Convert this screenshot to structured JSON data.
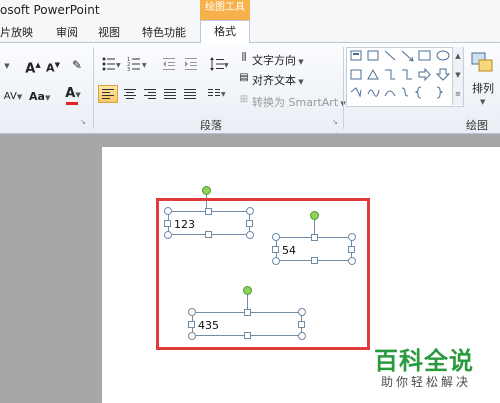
{
  "titlebar": {
    "title": "osoft PowerPoint",
    "contextual_tab": "绘图工具"
  },
  "tabs": [
    {
      "label": "片放映",
      "active": false
    },
    {
      "label": "审阅",
      "active": false
    },
    {
      "label": "视图",
      "active": false
    },
    {
      "label": "特色功能",
      "active": false
    },
    {
      "label": "格式",
      "active": true
    }
  ],
  "ribbon": {
    "font_group": {
      "grow_label": "A",
      "shrink_label": "A",
      "spacing_label": "AV",
      "case_label": "Aa",
      "color_label": "A"
    },
    "paragraph_group": {
      "label": "段落",
      "text_direction": "文字方向",
      "align_text": "对齐文本",
      "convert_smartart": "转换为 SmartArt"
    },
    "drawing_group": {
      "label": "绘图",
      "arrange": "排列"
    }
  },
  "slide": {
    "textboxes": [
      {
        "text": "123"
      },
      {
        "text": "54"
      },
      {
        "text": "435"
      }
    ]
  },
  "watermark": {
    "brand": "百科全说",
    "tagline": "助你轻松解决"
  },
  "colors": {
    "selection": "#e03a3a",
    "accent": "#f7b04a",
    "rotation_handle": "#8fd15a",
    "watermark": "#2a9a3e"
  }
}
